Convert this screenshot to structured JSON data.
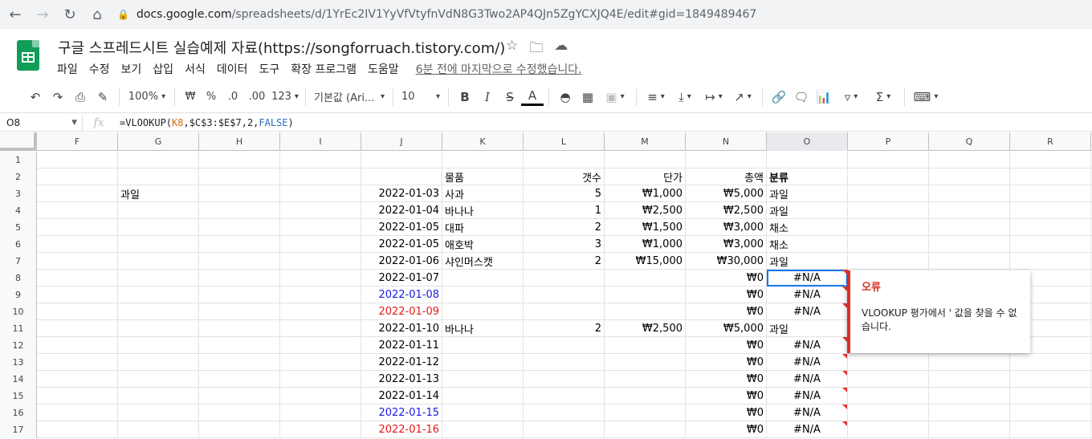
{
  "browser": {
    "url_host": "docs.google.com",
    "url_path": "/spreadsheets/d/1YrEc2IV1YyVfVtyfnVdN8G3Two2AP4QJn5ZgYCXJQ4E/edit#gid=1849489467"
  },
  "doc": {
    "title": "구글 스프레드시트 실습예제 자료(https://songforruach.tistory.com/)"
  },
  "menu": [
    "파일",
    "수정",
    "보기",
    "삽입",
    "서식",
    "데이터",
    "도구",
    "확장 프로그램",
    "도움말"
  ],
  "last_edit": "6분 전에 마지막으로 수정했습니다.",
  "toolbar": {
    "zoom": "100%",
    "currency": "₩",
    "percent": "%",
    "dec_decrease": ".0",
    "dec_increase": ".00",
    "more_formats": "123",
    "font": "기본값 (Ari...",
    "font_size": "10"
  },
  "formula_bar": {
    "name_box": "O8",
    "fx": "fx",
    "formula_prefix": "=VLOOKUP(",
    "formula_ref": "K8",
    "formula_middle": ",$C$3:$E$7,2,",
    "formula_bool": "FALSE",
    "formula_suffix": ")"
  },
  "columns": [
    "F",
    "G",
    "H",
    "I",
    "J",
    "K",
    "L",
    "M",
    "N",
    "O",
    "P",
    "Q",
    "R"
  ],
  "rows": [
    {
      "n": "1",
      "G": "",
      "J": "",
      "K": "",
      "L": "",
      "M": "",
      "N": "",
      "O": ""
    },
    {
      "n": "2",
      "G": "",
      "J": "",
      "K": "물품",
      "L": "갯수",
      "M": "단가",
      "N": "총액",
      "O": "분류"
    },
    {
      "n": "3",
      "G": "과일",
      "J": "2022-01-03",
      "K": "사과",
      "L": "5",
      "M": "₩1,000",
      "N": "₩5,000",
      "O": "과일"
    },
    {
      "n": "4",
      "G": "",
      "J": "2022-01-04",
      "K": "바나나",
      "L": "1",
      "M": "₩2,500",
      "N": "₩2,500",
      "O": "과일"
    },
    {
      "n": "5",
      "G": "",
      "J": "2022-01-05",
      "K": "대파",
      "L": "2",
      "M": "₩1,500",
      "N": "₩3,000",
      "O": "채소"
    },
    {
      "n": "6",
      "G": "",
      "J": "2022-01-05",
      "K": "애호박",
      "L": "3",
      "M": "₩1,000",
      "N": "₩3,000",
      "O": "채소"
    },
    {
      "n": "7",
      "G": "",
      "J": "2022-01-06",
      "K": "샤인머스캣",
      "L": "2",
      "M": "₩15,000",
      "N": "₩30,000",
      "O": "과일"
    },
    {
      "n": "8",
      "G": "",
      "J": "2022-01-07",
      "K": "",
      "L": "",
      "M": "",
      "N": "₩0",
      "O": "#N/A"
    },
    {
      "n": "9",
      "G": "",
      "J": "2022-01-08",
      "K": "",
      "L": "",
      "M": "",
      "N": "₩0",
      "O": "#N/A"
    },
    {
      "n": "10",
      "G": "",
      "J": "2022-01-09",
      "K": "",
      "L": "",
      "M": "",
      "N": "₩0",
      "O": "#N/A"
    },
    {
      "n": "11",
      "G": "",
      "J": "2022-01-10",
      "K": "바나나",
      "L": "2",
      "M": "₩2,500",
      "N": "₩5,000",
      "O": "과일"
    },
    {
      "n": "12",
      "G": "",
      "J": "2022-01-11",
      "K": "",
      "L": "",
      "M": "",
      "N": "₩0",
      "O": "#N/A"
    },
    {
      "n": "13",
      "G": "",
      "J": "2022-01-12",
      "K": "",
      "L": "",
      "M": "",
      "N": "₩0",
      "O": "#N/A"
    },
    {
      "n": "14",
      "G": "",
      "J": "2022-01-13",
      "K": "",
      "L": "",
      "M": "",
      "N": "₩0",
      "O": "#N/A"
    },
    {
      "n": "15",
      "G": "",
      "J": "2022-01-14",
      "K": "",
      "L": "",
      "M": "",
      "N": "₩0",
      "O": "#N/A"
    },
    {
      "n": "16",
      "G": "",
      "J": "2022-01-15",
      "K": "",
      "L": "",
      "M": "",
      "N": "₩0",
      "O": "#N/A"
    },
    {
      "n": "17",
      "G": "",
      "J": "2022-01-16",
      "K": "",
      "L": "",
      "M": "",
      "N": "₩0",
      "O": "#N/A"
    }
  ],
  "colors": {
    "weekend_sat": "#1a1ae6",
    "weekend_sun": "#e41a1a",
    "error": "#d93025",
    "selection": "#1a73e8",
    "brand": "#0f9d58"
  },
  "error_popup": {
    "title": "오류",
    "message": "VLOOKUP 평가에서 ' 값을 찾을 수 없습니다."
  }
}
